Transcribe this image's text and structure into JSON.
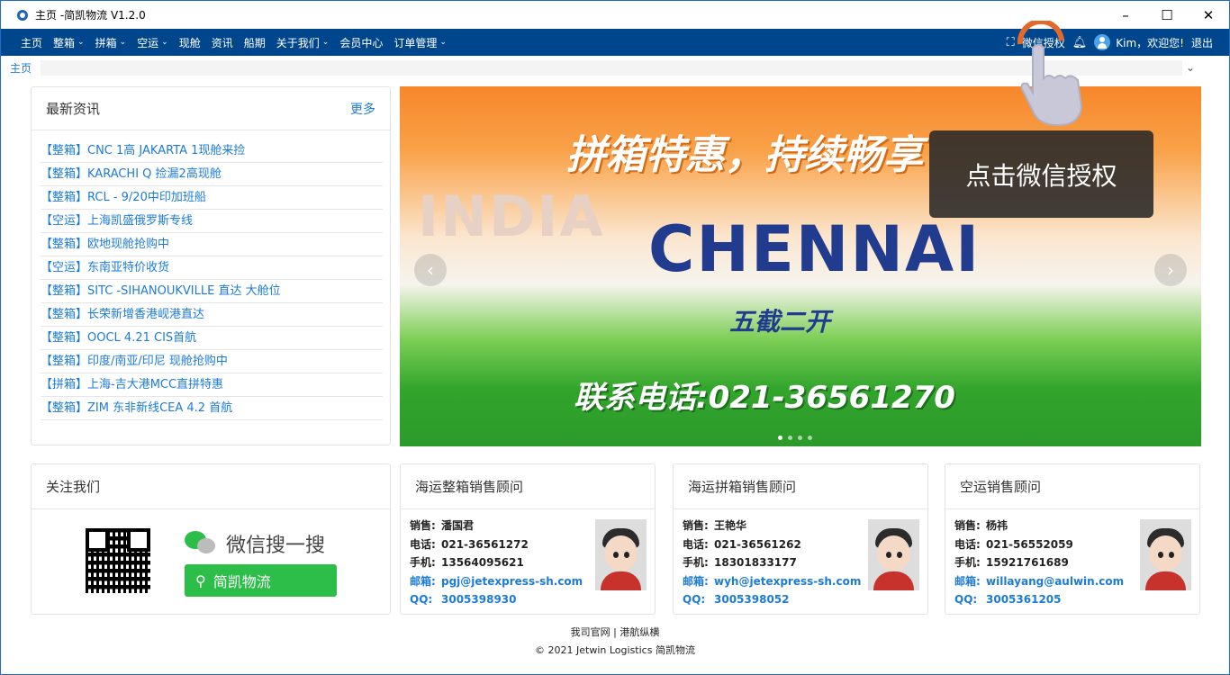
{
  "window": {
    "title": "主页 -简凯物流 V1.2.0",
    "minimize": "–",
    "maximize": "☐",
    "close": "✕"
  },
  "nav": {
    "items": [
      {
        "label": "主页",
        "dropdown": false
      },
      {
        "label": "整箱",
        "dropdown": true
      },
      {
        "label": "拼箱",
        "dropdown": true
      },
      {
        "label": "空运",
        "dropdown": true
      },
      {
        "label": "现舱",
        "dropdown": false
      },
      {
        "label": "资讯",
        "dropdown": false
      },
      {
        "label": "船期",
        "dropdown": false
      },
      {
        "label": "关于我们",
        "dropdown": true
      },
      {
        "label": "会员中心",
        "dropdown": false
      },
      {
        "label": "订单管理",
        "dropdown": true
      }
    ],
    "wechat_auth": "微信授权",
    "greeting": "Kim，欢迎您!",
    "logout": "退出"
  },
  "tabs": {
    "current": "主页"
  },
  "news": {
    "title": "最新资讯",
    "more": "更多",
    "items": [
      "【整箱】CNC 1高 JAKARTA 1现舱来捡",
      "【整箱】KARACHI Q 捡漏2高现舱",
      "【整箱】RCL - 9/20中印加班船",
      "【空运】上海凯盛俄罗斯专线",
      "【整箱】欧地现舱抢购中",
      "【空运】东南亚特价收货",
      "【整箱】SITC -SIHANOUKVILLE 直达 大舱位",
      "【整箱】长荣新增香港岘港直达",
      "【整箱】OOCL 4.21 CIS首航",
      "【整箱】印度/南亚/印尼 现舱抢购中",
      "【拼箱】上海-吉大港MCC直拼特惠",
      "【整箱】ZIM 东非新线CEA 4.2 首航"
    ]
  },
  "banner": {
    "watermark": "INDIA",
    "promo": "拼箱特惠，持续畅享",
    "city": "CHENNAI",
    "frequency": "五截二开",
    "phone": "联系电话:021-36561270",
    "prev": "‹",
    "next": "›"
  },
  "tooltip": {
    "text": "点击微信授权"
  },
  "follow": {
    "title": "关注我们",
    "wechat_label": "微信搜一搜",
    "search_label": "简凯物流"
  },
  "sales": [
    {
      "title": "海运整箱销售顾问",
      "sales_k": "销售:",
      "name": "潘国君",
      "tel_k": "电话:",
      "tel": "021-36561272",
      "mobile_k": "手机:",
      "mobile": "13564095621",
      "email_k": "邮箱:",
      "email": "pgj@jetexpress-sh.com",
      "qq_k": "QQ:",
      "qq": "3005398930"
    },
    {
      "title": "海运拼箱销售顾问",
      "sales_k": "销售:",
      "name": "王艳华",
      "tel_k": "电话:",
      "tel": "021-36561262",
      "mobile_k": "手机:",
      "mobile": "18301833177",
      "email_k": "邮箱:",
      "email": "wyh@jetexpress-sh.com",
      "qq_k": "QQ:",
      "qq": "3005398052"
    },
    {
      "title": "空运销售顾问",
      "sales_k": "销售:",
      "name": "杨祎",
      "tel_k": "电话:",
      "tel": "021-56552059",
      "mobile_k": "手机:",
      "mobile": "15921761689",
      "email_k": "邮箱:",
      "email": "willayang@aulwin.com",
      "qq_k": "QQ:",
      "qq": "3005361205"
    }
  ],
  "footer": {
    "links": "我司官网 | 港航纵横",
    "copyright": "© 2021 Jetwin Logistics 简凯物流"
  },
  "colors": {
    "nav_bg": "#00468c",
    "link": "#1d7bd8",
    "wechat_green": "#2dbe4a",
    "tooltip_bg": "#282828"
  }
}
